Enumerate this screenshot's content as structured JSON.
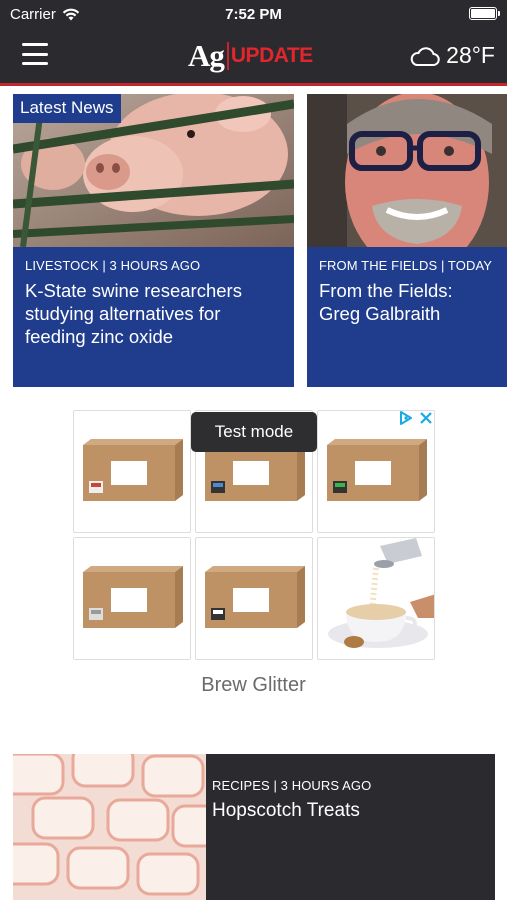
{
  "status_bar": {
    "carrier": "Carrier",
    "time": "7:52 PM"
  },
  "header": {
    "logo_ag": "Ag",
    "logo_update": "UPDATE",
    "temperature": "28°F",
    "weather_icon": "cloud-icon",
    "menu_icon": "hamburger-menu-icon"
  },
  "colors": {
    "brand_red": "#e1262d",
    "card_blue": "#1f3c8d",
    "header_dark": "#2b2b2f"
  },
  "news": [
    {
      "badge": "Latest News",
      "meta": "LIVESTOCK | 3 HOURS AGO",
      "title": "K-State swine researchers studying alternatives for feeding zinc oxide"
    },
    {
      "meta": "FROM THE FIELDS | TODAY",
      "title": "From the Fields: Greg Galbraith"
    }
  ],
  "ad": {
    "badge": "Test mode",
    "caption": "Brew Glitter",
    "icons": [
      "ad-choices-icon",
      "close-icon"
    ]
  },
  "recipe": {
    "meta": "RECIPES | 3 HOURS AGO",
    "title": "Hopscotch Treats"
  }
}
